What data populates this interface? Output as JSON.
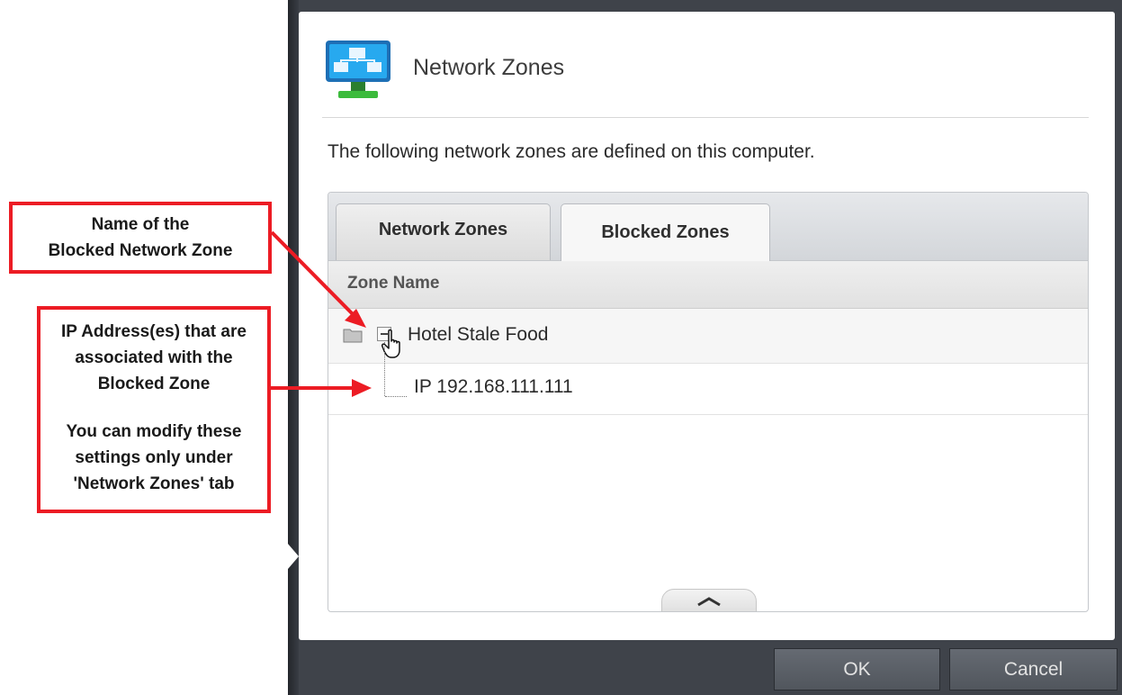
{
  "dialog": {
    "title": "Network Zones",
    "description": "The following network zones are defined on this computer.",
    "tabs": [
      {
        "label": "Network Zones",
        "active": false
      },
      {
        "label": "Blocked Zones",
        "active": true
      }
    ],
    "column_header": "Zone Name",
    "zones": [
      {
        "name": "Hotel Stale Food",
        "expanded": true,
        "entries": [
          "IP 192.168.111.111"
        ]
      }
    ],
    "buttons": {
      "ok": "OK",
      "cancel": "Cancel"
    }
  },
  "annotations": {
    "name_callout": [
      "Name of the",
      "Blocked Network Zone"
    ],
    "ip_callout": [
      "IP Address(es) that are",
      "associated with the",
      "Blocked Zone",
      "",
      "You can modify these",
      "settings only under",
      "'Network Zones' tab"
    ]
  },
  "colors": {
    "frame": "#3f434a",
    "annotation": "#ec1c24",
    "tab_active": "#f7f7f7",
    "icon_accent": "#12a6e6"
  },
  "icons": [
    "network-zones-icon",
    "folder-icon",
    "collapse-icon",
    "hand-cursor-icon",
    "chevron-up-icon"
  ]
}
